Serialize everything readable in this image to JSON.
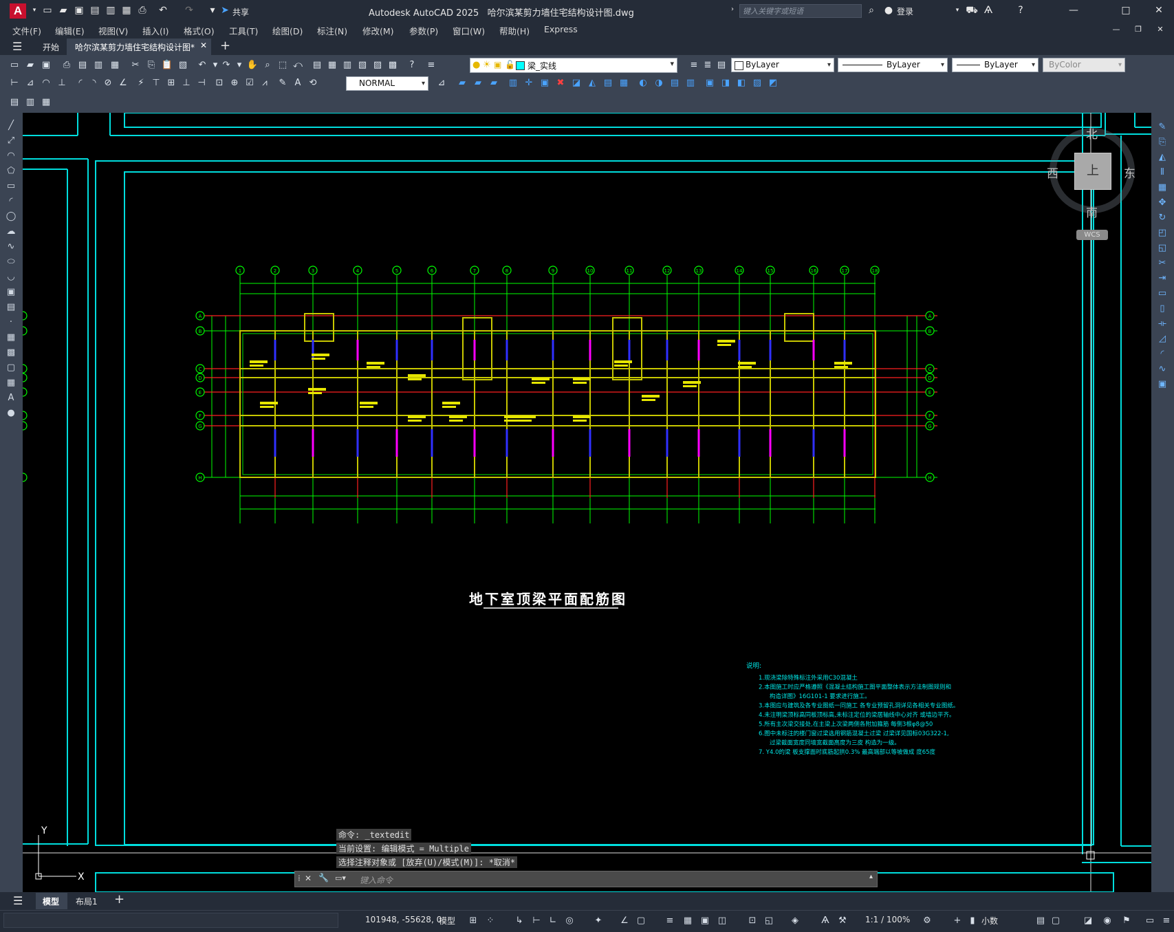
{
  "titlebar": {
    "app_name": "Autodesk AutoCAD 2025",
    "file_name": "哈尔滨某剪力墙住宅结构设计图.dwg",
    "share_label": "共享",
    "search_placeholder": "键入关键字或短语",
    "login_label": "登录"
  },
  "menu": [
    "文件(F)",
    "编辑(E)",
    "视图(V)",
    "插入(I)",
    "格式(O)",
    "工具(T)",
    "绘图(D)",
    "标注(N)",
    "修改(M)",
    "参数(P)",
    "窗口(W)",
    "帮助(H)",
    "Express"
  ],
  "tabs": {
    "start": "开始",
    "document": "哈尔滨某剪力墙住宅结构设计图*"
  },
  "toolbar": {
    "dimstyle": "NORMAL",
    "layer": "梁_实线",
    "color": "ByLayer",
    "linetype": "ByLayer",
    "lineweight": "ByLayer",
    "plotstyle": "ByColor"
  },
  "viewcube": {
    "north": "北",
    "south": "南",
    "east": "东",
    "west": "西",
    "face": "上",
    "wcs": "WCS"
  },
  "drawing": {
    "title": "地下室顶梁平面配筋图",
    "notes_header": "说明:",
    "notes": [
      "1.现浇梁除特殊标注外采用C30混凝土",
      "2.本图施工时应严格遵照《混凝土结构施工图平面整体表示方法制图规则和",
      "构造详图》16G101-1 要求进行施工。",
      "3.本图应与建筑及各专业图纸一同施工 各专业预留孔洞详见各相关专业图纸。",
      "4.未注明梁顶标高同板顶标高,未标注定位的梁居轴线中心对齐 或墙边平齐。",
      "5.所有主次梁交接处,在主梁上次梁两侧各附加箍筋 每侧3根φ8@50",
      "6.图中未标注的楼门窗过梁选用钢筋混凝土过梁 过梁详见国标03G322-1,",
      "过梁截面宽度同墙宽截面高度为三皮 构造为一级。",
      "7. Y4.0的梁 板支撑面时底筋起拱0.3% 最高端部以等坡做成 度65度"
    ],
    "axis_labels_top": [
      "1",
      "2",
      "3",
      "4",
      "5",
      "6",
      "7",
      "8",
      "9",
      "10",
      "11",
      "12",
      "13",
      "14",
      "15",
      "16",
      "17",
      "18",
      "19",
      "20"
    ],
    "axis_labels_side": [
      "A",
      "B",
      "C",
      "D",
      "E",
      "F",
      "G",
      "H"
    ],
    "ucs_y": "Y",
    "ucs_x": "X"
  },
  "command": {
    "history": [
      "命令: _textedit",
      "当前设置: 编辑模式 = Multiple",
      "选择注释对象或 [放弃(U)/模式(M)]: *取消*"
    ],
    "input_placeholder": "键入命令"
  },
  "layout_tabs": {
    "model": "模型",
    "layout1": "布局1"
  },
  "status": {
    "coords": "101948, -55628, 0",
    "space": "模型",
    "scale": "1:1 / 100%",
    "units": "小数"
  }
}
